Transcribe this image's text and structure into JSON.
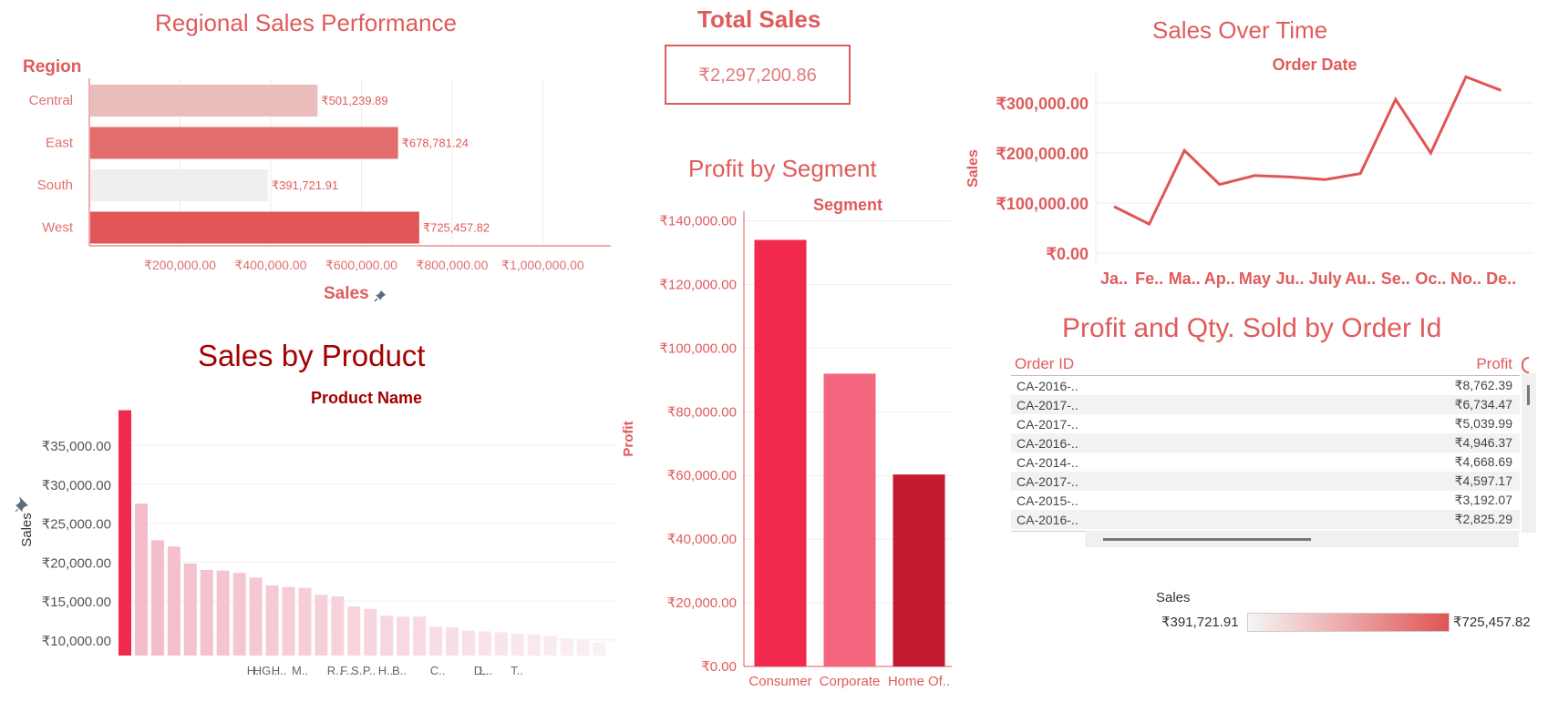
{
  "regional": {
    "title": "Regional Sales Performance",
    "dim_label": "Region",
    "measure_label": "Sales",
    "pin_icon": "pin-icon",
    "chart_data": {
      "type": "bar",
      "orientation": "horizontal",
      "categories": [
        "Central",
        "East",
        "South",
        "West"
      ],
      "values": [
        501239.89,
        678781.24,
        391721.91,
        725457.82
      ],
      "value_labels": [
        "₹501,239.89",
        "₹678,781.24",
        "₹391,721.91",
        "₹725,457.82"
      ],
      "colors": [
        "#ebbcbc",
        "#e36c6c",
        "#efefef",
        "#e05555"
      ],
      "xlabel": "Sales",
      "ylabel": "Region",
      "xlim": [
        0,
        1150000
      ],
      "x_ticks": [
        200000,
        400000,
        600000,
        800000,
        1000000
      ],
      "x_tick_labels": [
        "₹200,000.00",
        "₹400,000.00",
        "₹600,000.00",
        "₹800,000.00",
        "₹1,000,000.00"
      ]
    }
  },
  "total": {
    "title": "Total Sales",
    "value": "₹2,297,200.86"
  },
  "segment": {
    "title": "Profit by Segment",
    "dim_label": "Segment",
    "chart_data": {
      "type": "bar",
      "categories": [
        "Consumer",
        "Corporate",
        "Home Of.."
      ],
      "values": [
        134000,
        91980,
        60300
      ],
      "colors": [
        "#f2294e",
        "#f4667d",
        "#c21a30"
      ],
      "xlabel": "Segment",
      "ylabel": "Profit",
      "ylim": [
        0,
        143000
      ],
      "y_ticks": [
        0,
        20000,
        40000,
        60000,
        80000,
        100000,
        120000,
        140000
      ],
      "y_tick_labels": [
        "₹0.00",
        "₹20,000.00",
        "₹40,000.00",
        "₹60,000.00",
        "₹80,000.00",
        "₹100,000.00",
        "₹120,000.00",
        "₹140,000.00"
      ]
    }
  },
  "overtime": {
    "title": "Sales Over Time",
    "dim_label": "Order Date",
    "chart_data": {
      "type": "line",
      "categories": [
        "Ja..",
        "Fe..",
        "Ma..",
        "Ap..",
        "May",
        "Ju..",
        "July",
        "Au..",
        "Se..",
        "Oc..",
        "No..",
        "De.."
      ],
      "values": [
        93000,
        58000,
        205000,
        137000,
        155000,
        152000,
        147000,
        159000,
        307000,
        200000,
        352000,
        325000
      ],
      "color": "#e05555",
      "xlabel": "Order Date",
      "ylabel": "Sales",
      "ylim": [
        -20000,
        380000
      ],
      "y_ticks": [
        0,
        100000,
        200000,
        300000
      ],
      "y_tick_labels": [
        "₹0.00",
        "₹100,000.00",
        "₹200,000.00",
        "₹300,000.00"
      ]
    }
  },
  "product": {
    "title": "Sales by Product",
    "dim_label": "Product Name",
    "ylabel": "Sales",
    "chart_data": {
      "type": "bar",
      "values": [
        39500,
        27500,
        22800,
        22000,
        19800,
        19000,
        18900,
        18600,
        18000,
        17000,
        16800,
        16700,
        15800,
        15600,
        14300,
        14000,
        13100,
        13000,
        13000,
        11700,
        11600,
        11200,
        11100,
        11000,
        10800,
        10700,
        10500,
        10200,
        9900,
        9700
      ],
      "ylim": [
        8000,
        40500
      ],
      "y_ticks": [
        10000,
        15000,
        20000,
        25000,
        30000,
        35000
      ],
      "y_tick_labels": [
        "₹10,000.00",
        "₹15,000.00",
        "₹20,000.00",
        "₹25,000.00",
        "₹30,000.00",
        "₹35,000.00"
      ],
      "ylabel": "Sales",
      "visible_name_labels": [
        "H..",
        "HG..",
        "H..",
        "M..",
        "R..",
        "F..",
        "S..",
        "P..",
        "H..",
        "B..",
        "C..",
        "D..",
        "L..",
        "T.."
      ]
    }
  },
  "table": {
    "title": "Profit and Qty. Sold by Order Id",
    "col_order": "Order ID",
    "col_profit": "Profit",
    "rows": [
      {
        "order": "CA-2016-..",
        "profit": "₹8,762.39"
      },
      {
        "order": "CA-2017-..",
        "profit": "₹6,734.47"
      },
      {
        "order": "CA-2017-..",
        "profit": "₹5,039.99"
      },
      {
        "order": "CA-2016-..",
        "profit": "₹4,946.37"
      },
      {
        "order": "CA-2014-..",
        "profit": "₹4,668.69"
      },
      {
        "order": "CA-2017-..",
        "profit": "₹4,597.17"
      },
      {
        "order": "CA-2015-..",
        "profit": "₹3,192.07"
      },
      {
        "order": "CA-2016-..",
        "profit": "₹2,825.29"
      }
    ]
  },
  "legend": {
    "title": "Sales",
    "min": "₹391,721.91",
    "max": "₹725,457.82",
    "color_min": "#f6f6f6",
    "color_max": "#e05555"
  }
}
